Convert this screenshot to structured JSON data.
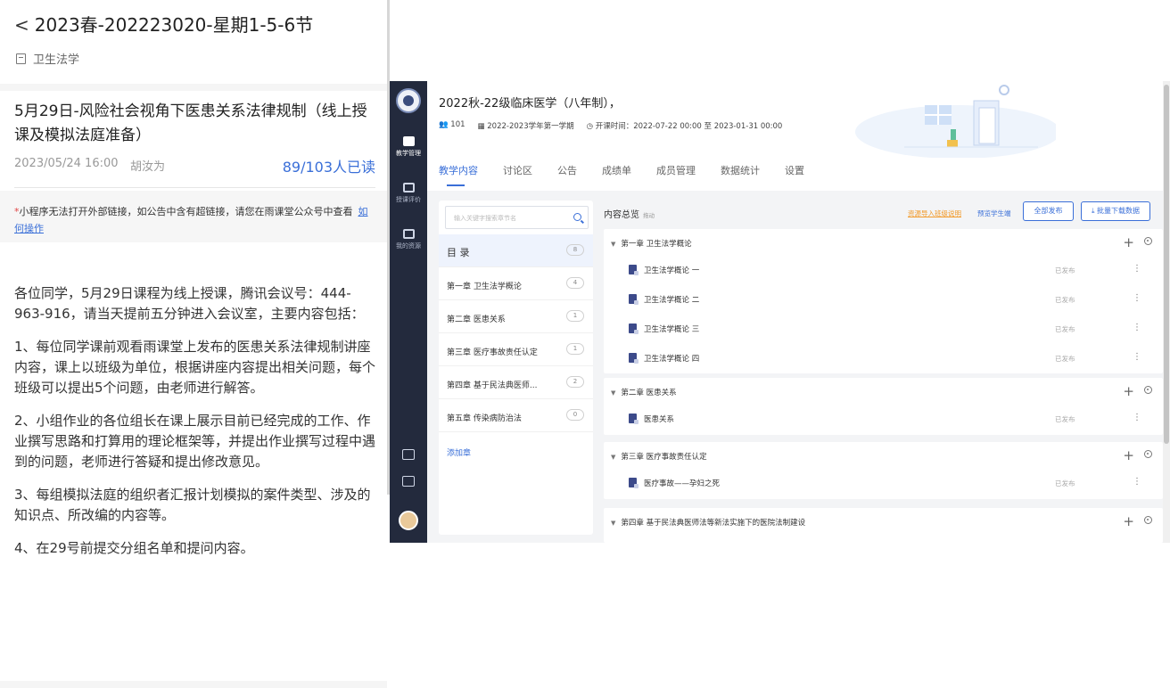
{
  "left_panel": {
    "header": {
      "back_glyph": "<",
      "title": "2023春-202223020-星期1-5-6节",
      "course_name": "卫生法学"
    },
    "notice": {
      "title": "5月29日-风险社会视角下医患关系法律规制（线上授课及模拟法庭准备）",
      "date": "2023/05/24 16:00",
      "author": "胡汝为",
      "read_count": "89/103人已读"
    },
    "warning": {
      "star": "*",
      "text": "小程序无法打开外部链接，如公告中含有超链接，请您在雨课堂公众号中查看",
      "link": "如何操作"
    },
    "body": [
      "各位同学，5月29日课程为线上授课，腾讯会议号：444-963-916，请当天提前五分钟进入会议室，主要内容包括：",
      "1、每位同学课前观看雨课堂上发布的医患关系法律规制讲座内容，课上以班级为单位，根据讲座内容提出相关问题，每个班级可以提出5个问题，由老师进行解答。",
      "2、小组作业的各位组长在课上展示目前已经完成的工作、作业撰写思路和打算用的理论框架等，并提出作业撰写过程中遇到的问题，老师进行答疑和提出修改意见。",
      "3、每组模拟法庭的组织者汇报计划模拟的案件类型、涉及的知识点、所改编的内容等。",
      "4、在29号前提交分组名单和提问内容。"
    ]
  },
  "right_panel": {
    "rail": {
      "items": [
        {
          "label": "教学管理"
        },
        {
          "label": "授课评价"
        },
        {
          "label": "我的资源"
        }
      ]
    },
    "course": {
      "title": "2022秋-22级临床医学（八年制），",
      "students": "101",
      "term": "2022-2023学年第一学期",
      "open_time": "开课时间：2022-07-22 00:00 至 2023-01-31 00:00"
    },
    "tabs": [
      "教学内容",
      "讨论区",
      "公告",
      "成绩单",
      "成员管理",
      "数据统计",
      "设置"
    ],
    "active_tab": 0,
    "chapter_list": {
      "search_placeholder": "输入关键字搜索章节名",
      "head": {
        "label": "目 录",
        "count": "8"
      },
      "chapters": [
        {
          "label": "第一章 卫生法学概论",
          "count": "4"
        },
        {
          "label": "第二章 医患关系",
          "count": "1"
        },
        {
          "label": "第三章 医疗事故责任认定",
          "count": "1"
        },
        {
          "label": "第四章 基于民法典医师...",
          "count": "2"
        },
        {
          "label": "第五章 传染病防治法",
          "count": "0"
        }
      ],
      "add_label": "添加章"
    },
    "content": {
      "title": "内容总览",
      "subtitle": "拖动",
      "link_import": "资源导入班级说明",
      "link_preview": "预览学生端",
      "btn_publish_all": "全部发布",
      "btn_download": "⤓ 批量下载数据",
      "sections": [
        {
          "title": "第一章 卫生法学概论",
          "lessons": [
            {
              "name": "卫生法学概论 一",
              "status": "已发布"
            },
            {
              "name": "卫生法学概论 二",
              "status": "已发布"
            },
            {
              "name": "卫生法学概论 三",
              "status": "已发布"
            },
            {
              "name": "卫生法学概论 四",
              "status": "已发布"
            }
          ]
        },
        {
          "title": "第二章 医患关系",
          "lessons": [
            {
              "name": "医患关系",
              "status": "已发布"
            }
          ]
        },
        {
          "title": "第三章 医疗事故责任认定",
          "lessons": [
            {
              "name": "医疗事故——孕妇之死",
              "status": "已发布"
            }
          ]
        },
        {
          "title": "第四章 基于民法典医师法等新法实施下的医院法制建设",
          "lessons": []
        }
      ]
    }
  }
}
